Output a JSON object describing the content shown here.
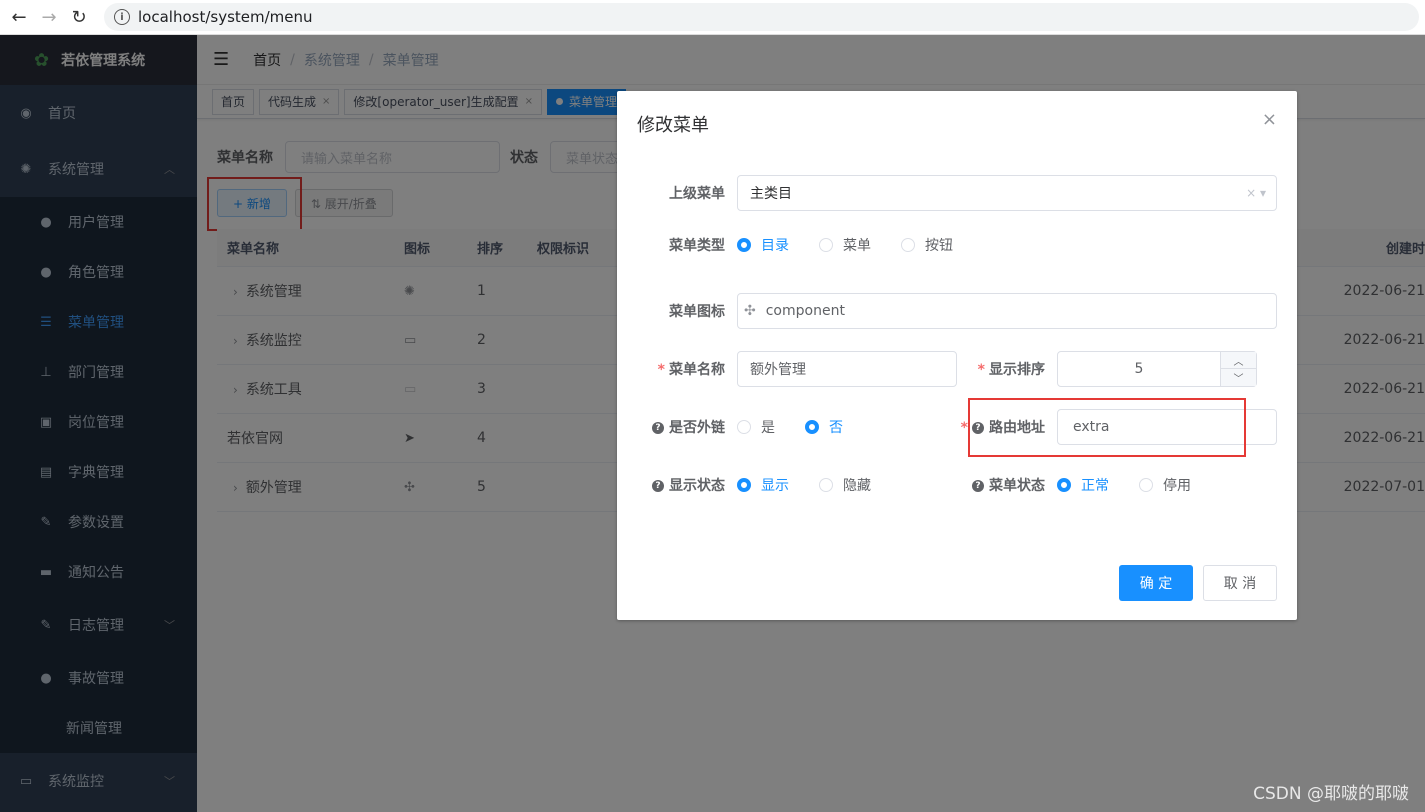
{
  "browser": {
    "url": "localhost/system/menu"
  },
  "sidebar": {
    "title": "若依管理系统",
    "items": [
      {
        "label": "首页",
        "icon": "dashboard-icon"
      },
      {
        "label": "系统管理",
        "icon": "gear-icon"
      }
    ],
    "sub_items": [
      {
        "label": "用户管理",
        "icon": "user-icon"
      },
      {
        "label": "角色管理",
        "icon": "peoples-icon"
      },
      {
        "label": "菜单管理",
        "icon": "tree-table-icon"
      },
      {
        "label": "部门管理",
        "icon": "tree-icon"
      },
      {
        "label": "岗位管理",
        "icon": "post-icon"
      },
      {
        "label": "字典管理",
        "icon": "dict-icon"
      },
      {
        "label": "参数设置",
        "icon": "edit-icon"
      },
      {
        "label": "通知公告",
        "icon": "message-icon"
      },
      {
        "label": "日志管理",
        "icon": "log-icon"
      },
      {
        "label": "事故管理",
        "icon": "user-icon"
      },
      {
        "label": "新闻管理",
        "icon": ""
      }
    ],
    "bottom_item": {
      "label": "系统监控",
      "icon": "monitor-icon"
    }
  },
  "navbar": {
    "breadcrumb": [
      "首页",
      "系统管理",
      "菜单管理"
    ]
  },
  "tags": [
    {
      "label": "首页"
    },
    {
      "label": "代码生成"
    },
    {
      "label": "修改[operator_user]生成配置"
    },
    {
      "label": "菜单管理"
    }
  ],
  "search": {
    "name_label": "菜单名称",
    "name_placeholder": "请输入菜单名称",
    "status_label": "状态",
    "status_placeholder": "菜单状态"
  },
  "toolbar": {
    "add_label": "+ 新增",
    "expand_label": "⇅ 展开/折叠"
  },
  "table": {
    "headers": [
      "菜单名称",
      "图标",
      "排序",
      "权限标识",
      "创建时"
    ],
    "rows": [
      {
        "name": "系统管理",
        "sort": "1",
        "date": "2022-06-21",
        "expandable": true
      },
      {
        "name": "系统监控",
        "sort": "2",
        "date": "2022-06-21",
        "expandable": true
      },
      {
        "name": "系统工具",
        "sort": "3",
        "date": "2022-06-21",
        "expandable": true
      },
      {
        "name": "若依官网",
        "sort": "4",
        "date": "2022-06-21",
        "expandable": false
      },
      {
        "name": "额外管理",
        "sort": "5",
        "date": "2022-07-01",
        "expandable": true
      }
    ]
  },
  "dialog": {
    "title": "修改菜单",
    "parent_label": "上级菜单",
    "parent_value": "主类目",
    "type_label": "菜单类型",
    "type_options": [
      "目录",
      "菜单",
      "按钮"
    ],
    "icon_label": "菜单图标",
    "icon_value": "component",
    "name_label": "菜单名称",
    "name_value": "额外管理",
    "sort_label": "显示排序",
    "sort_value": "5",
    "external_label": "是否外链",
    "external_options": [
      "是",
      "否"
    ],
    "path_label": "路由地址",
    "path_value": "extra",
    "visible_label": "显示状态",
    "visible_options": [
      "显示",
      "隐藏"
    ],
    "status_label": "菜单状态",
    "status_options": [
      "正常",
      "停用"
    ],
    "ok_label": "确 定",
    "cancel_label": "取 消"
  },
  "watermark": "CSDN @耶啵的耶啵",
  "colors": {
    "primary": "#1890ff",
    "sidebar": "#304156",
    "highlight": "#e53935"
  }
}
